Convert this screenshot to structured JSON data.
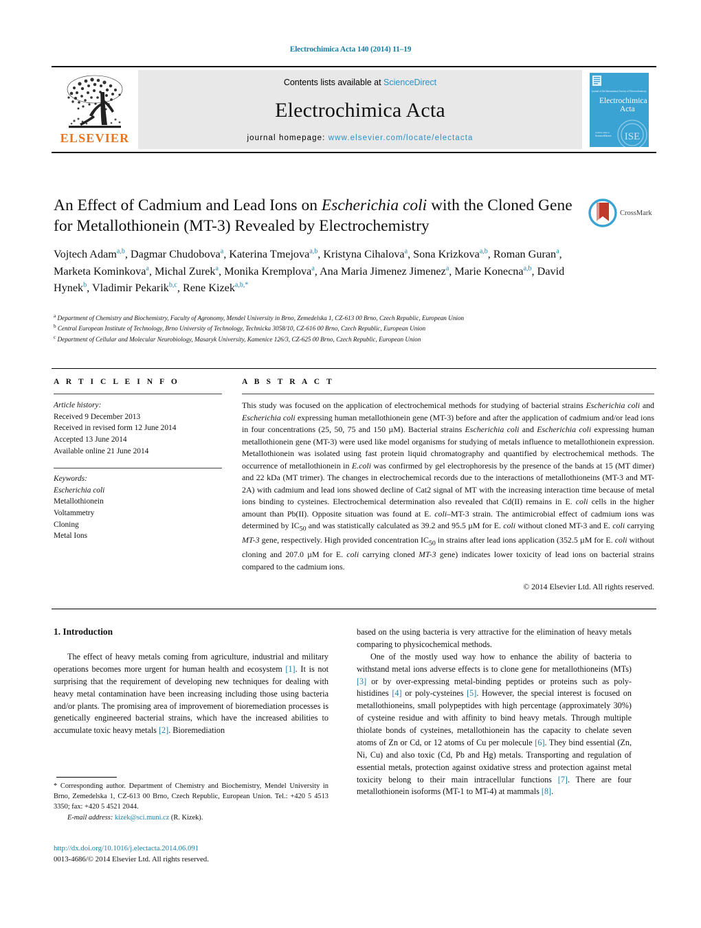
{
  "running_head": "Electrochimica Acta 140 (2014) 11–19",
  "masthead": {
    "publisher_name": "ELSEVIER",
    "contents_prefix": "Contents lists available at ",
    "contents_link": "ScienceDirect",
    "journal_name": "Electrochimica Acta",
    "homepage_label": "journal homepage:",
    "homepage_url": "www.elsevier.com/locate/electacta",
    "cover_title_line1": "Electrochimica",
    "cover_title_line2": "Acta",
    "cover_overline": "journal of the International Society of Electrochemistry",
    "cover_footer": "available online at",
    "cover_footer_brand": "ScienceDirect"
  },
  "article": {
    "title_part1": "An Effect of Cadmium and Lead Ions on ",
    "title_italic1": "Escherichia coli",
    "title_part2": " with the Cloned Gene for Metallothionein (MT-3) Revealed by Electrochemistry",
    "crossmark_label": "CrossMark",
    "authors": [
      {
        "name": "Vojtech Adam",
        "sup": "a,b",
        "sep": ", "
      },
      {
        "name": "Dagmar Chudobova",
        "sup": "a",
        "sep": ", "
      },
      {
        "name": "Katerina Tmejova",
        "sup": "a,b",
        "sep": ", "
      },
      {
        "name": "Kristyna Cihalova",
        "sup": "a",
        "sep": ", "
      },
      {
        "name": "Sona Krizkova",
        "sup": "a,b",
        "sep": ", "
      },
      {
        "name": "Roman Guran",
        "sup": "a",
        "sep": ", "
      },
      {
        "name": "Marketa Kominkova",
        "sup": "a",
        "sep": ", "
      },
      {
        "name": "Michal Zurek",
        "sup": "a",
        "sep": ", "
      },
      {
        "name": "Monika Kremplova",
        "sup": "a",
        "sep": ", "
      },
      {
        "name": "Ana Maria Jimenez Jimenez",
        "sup": "a",
        "sep": ", "
      },
      {
        "name": "Marie Konecna",
        "sup": "a,b",
        "sep": ", "
      },
      {
        "name": "David Hynek",
        "sup": "b",
        "sep": ", "
      },
      {
        "name": "Vladimir Pekarik",
        "sup": "b,c",
        "sep": ", "
      },
      {
        "name": "Rene Kizek",
        "sup": "a,b,*",
        "sep": ""
      }
    ],
    "affiliations": [
      {
        "mark": "a",
        "text": "Department of Chemistry and Biochemistry, Faculty of Agronomy, Mendel University in Brno, Zemedelska 1, CZ-613 00 Brno, Czech Republic, European Union"
      },
      {
        "mark": "b",
        "text": "Central European Institute of Technology, Brno University of Technology, Technicka 3058/10, CZ-616 00 Brno, Czech Republic, European Union"
      },
      {
        "mark": "c",
        "text": "Department of Cellular and Molecular Neurobiology, Masaryk University, Kamenice 126/3, CZ-625 00 Brno, Czech Republic, European Union"
      }
    ]
  },
  "article_info": {
    "heading": "A R T I C L E   I N F O",
    "history_label": "Article history:",
    "history": [
      "Received 9 December 2013",
      "Received in revised form 12 June 2014",
      "Accepted 13 June 2014",
      "Available online 21 June 2014"
    ],
    "keywords_label": "Keywords:",
    "keywords": [
      "Escherichia coli",
      "Metallothionein",
      "Voltammetry",
      "Cloning",
      "Metal Ions"
    ],
    "keyword_italic_index": 0
  },
  "abstract": {
    "heading": "A B S T R A C T",
    "copyright": "© 2014 Elsevier Ltd. All rights reserved.",
    "text": "This study was focused on the application of electrochemical methods for studying of bacterial strains Escherichia coli and Escherichia coli expressing human metallothionein gene (MT-3) before and after the application of cadmium and/or lead ions in four concentrations (25, 50, 75 and 150 µM). Bacterial strains Escherichia coli and Escherichia coli expressing human metallothionein gene (MT-3) were used like model organisms for studying of metals influence to metallothionein expression. Metallothionein was isolated using fast protein liquid chromatography and quantified by electrochemical methods. The occurrence of metallothionein in E.coli was confirmed by gel electrophoresis by the presence of the bands at 15 (MT dimer) and 22 kDa (MT trimer). The changes in electrochemical records due to the interactions of metallothioneins (MT-3 and MT-2A) with cadmium and lead ions showed decline of Cat2 signal of MT with the increasing interaction time because of metal ions binding to cysteines. Electrochemical determination also revealed that Cd(II) remains in E. coli cells in the higher amount than Pb(II). Opposite situation was found at E. coli–MT-3 strain. The antimicrobial effect of cadmium ions was determined by IC50 and was statistically calculated as 39.2 and 95.5 µM for E. coli without cloned MT-3 and E. coli carrying MT-3 gene, respectively. High provided concentration IC50 in strains after lead ions application (352.5 µM for E. coli without cloning and 207.0 µM for E. coli carrying cloned MT-3 gene) indicates lower toxicity of lead ions on bacterial strains compared to the cadmium ions."
  },
  "introduction": {
    "heading": "1.  Introduction",
    "left_paragraph": "The effect of heavy metals coming from agriculture, industrial and military operations becomes more urgent for human health and ecosystem [1]. It is not surprising that the requirement of developing new techniques for dealing with heavy metal contamination have been increasing including those using bacteria and/or plants. The promising area of improvement of bioremediation processes is genetically engineered bacterial strains, which have the increased abilities to accumulate toxic heavy metals [2]. Bioremediation",
    "right_paragraph_1": "based on the using bacteria is very attractive for the elimination of heavy metals comparing to physicochemical methods.",
    "right_paragraph_2": "One of the mostly used way how to enhance the ability of bacteria to withstand metal ions adverse effects is to clone gene for metallothioneins (MTs) [3] or by over-expressing metal-binding peptides or proteins such as poly-histidines [4] or poly-cysteines [5]. However, the special interest is focused on metallothioneins, small polypeptides with high percentage (approximately 30%) of cysteine residue and with affinity to bind heavy metals. Through multiple thiolate bonds of cysteines, metallothionein has the capacity to chelate seven atoms of Zn or Cd, or 12 atoms of Cu per molecule [6]. They bind essential (Zn, Ni, Cu) and also toxic (Cd, Pb and Hg) metals. Transporting and regulation of essential metals, protection against oxidative stress and protection against metal toxicity belong to their main intracellular functions [7]. There are four metallothionein isoforms (MT-1 to MT-4) at mammals [8]."
  },
  "footer": {
    "corresponding_star": "*",
    "corresponding_text": "Corresponding author. Department of Chemistry and Biochemistry, Mendel University in Brno, Zemedelska 1, CZ-613 00 Brno, Czech Republic, European Union. Tel.: +420 5 4513 3350; fax: +420 5 4521 2044.",
    "email_label": "E-mail address:",
    "email": "kizek@sci.muni.cz",
    "email_suffix": "(R. Kizek).",
    "doi_url": "http://dx.doi.org/10.1016/j.electacta.2014.06.091",
    "issn_line": "0013-4686/© 2014 Elsevier Ltd. All rights reserved."
  },
  "colors": {
    "link": "#1a7fa8",
    "sciencedirect": "#2a90c8",
    "elsevier_orange": "#e8731a",
    "cover_blue": "#2f9fd0",
    "crossmark_red": "#c0392b"
  }
}
